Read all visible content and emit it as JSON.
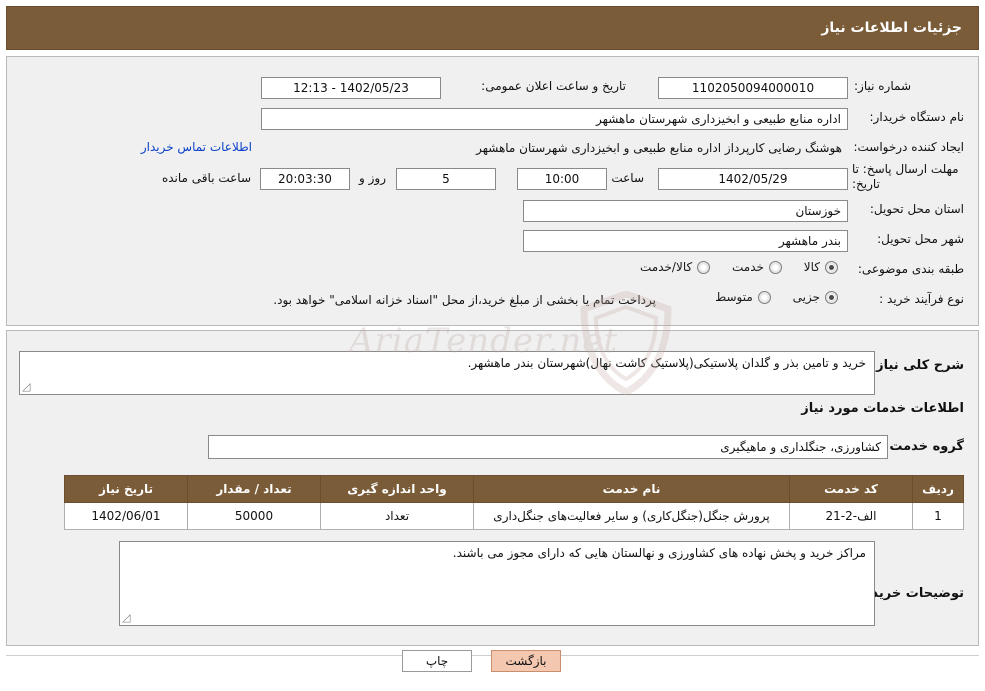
{
  "header": {
    "title": "جزئیات اطلاعات نیاز"
  },
  "form": {
    "need_number_label": "شماره نیاز:",
    "need_number_value": "1102050094000010",
    "announce_datetime_label": "تاریخ و ساعت اعلان عمومی:",
    "announce_datetime_value": "1402/05/23 - 12:13",
    "buyer_org_label": "نام دستگاه خریدار:",
    "buyer_org_value": "اداره منابع طبیعی و ابخیزداری شهرستان ماهشهر",
    "requester_label": "ایجاد کننده درخواست:",
    "requester_value": "هوشنگ رضایی کارپرداز اداره منابع طبیعی و ابخیزداری شهرستان ماهشهر",
    "contact_link": "اطلاعات تماس خریدار",
    "deadline_label": "مهلت ارسال پاسخ: تا تاریخ:",
    "deadline_date": "1402/05/29",
    "hour_label": "ساعت",
    "deadline_time": "10:00",
    "days_remaining": "5",
    "days_word": "روز و",
    "time_remaining": "20:03:30",
    "remaining_suffix": "ساعت باقی مانده",
    "province_label": "استان محل تحویل:",
    "province_value": "خوزستان",
    "city_label": "شهر محل تحویل:",
    "city_value": "بندر ماهشهر",
    "category_label": "طبقه بندی موضوعی:",
    "category_options": [
      {
        "label": "کالا",
        "selected": true
      },
      {
        "label": "خدمت",
        "selected": false
      },
      {
        "label": "کالا/خدمت",
        "selected": false
      }
    ],
    "process_label": "نوع فرآیند خرید :",
    "process_options": [
      {
        "label": "جزیی",
        "selected": true
      },
      {
        "label": "متوسط",
        "selected": false
      }
    ],
    "process_note": "پرداخت تمام یا بخشی از مبلغ خرید،از محل \"اسناد خزانه اسلامی\" خواهد بود."
  },
  "body": {
    "general_desc_label": "شرح کلی نیاز:",
    "general_desc_value": "خرید و تامین بذر و گلدان پلاستیکی(پلاستیک کاشت نهال)شهرستان بندر ماهشهر.",
    "services_info_title": "اطلاعات خدمات مورد نیاز",
    "service_group_label": "گروه خدمت:",
    "service_group_value": "کشاورزی، جنگلداری و ماهیگیری",
    "buyer_notes_label": "توضیحات خریدار:",
    "buyer_notes_value": "مراکز خرید و پخش نهاده های کشاورزی و نهالستان هایی که دارای مجوز می باشند."
  },
  "table": {
    "columns": [
      "ردیف",
      "کد خدمت",
      "نام خدمت",
      "واحد اندازه گیری",
      "تعداد / مقدار",
      "تاریخ نیاز"
    ],
    "rows": [
      {
        "row": "1",
        "code": "الف-2-21",
        "name": "پرورش جنگل(جنگل‌کاری) و سایر فعالیت‌های جنگل‌داری",
        "unit": "تعداد",
        "qty": "50000",
        "date": "1402/06/01"
      }
    ]
  },
  "footer": {
    "print_label": "چاپ",
    "back_label": "بازگشت"
  },
  "watermark": {
    "text": "AriaTender.net"
  },
  "colors": {
    "header_brown": "#7b5c38",
    "link_blue": "#0b42c9",
    "back_button": "#f3c7b0"
  }
}
